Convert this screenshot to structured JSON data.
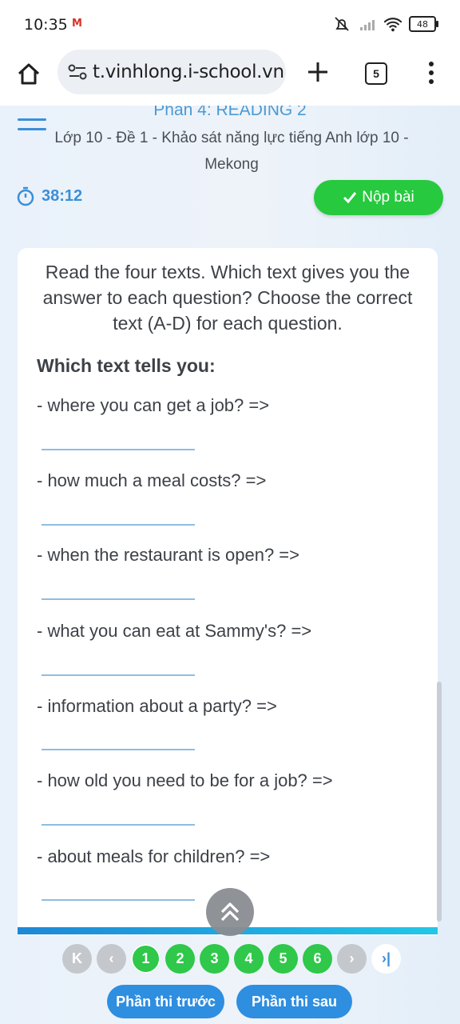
{
  "status": {
    "time": "10:35",
    "gmail": "M",
    "battery": "48"
  },
  "browser": {
    "url": "t.vinhlong.i-school.vn",
    "tab_count": "5"
  },
  "header": {
    "part_title": "Phần 4: READING 2",
    "exam_title": "Lớp 10 - Đề 1 - Khảo sát năng lực tiếng Anh lớp 10 - Mekong",
    "timer": "38:12",
    "submit_label": "Nộp bài"
  },
  "card": {
    "instructions": "Read the four texts. Which text gives you the answer to each question? Choose the correct text (A-D) for each question.",
    "subhead": "Which text tells you:",
    "questions": [
      "- where you can get a job? =>",
      "- how much a meal costs? =>",
      "- when the restaurant is open? =>",
      "- what you can eat at Sammy's? =>",
      "- information about a party? =>",
      "- how old you need to be for a job? =>",
      "- about meals for children? =>"
    ]
  },
  "pager": {
    "first": "K",
    "prev": "‹",
    "pages": [
      "1",
      "2",
      "3",
      "4",
      "5",
      "6"
    ],
    "next": "›",
    "last": "›|"
  },
  "nav": {
    "prev_part": "Phần thi trước",
    "next_part": "Phần thi sau"
  },
  "colors": {
    "accent_blue": "#3a8fd8",
    "submit_green": "#27c93f",
    "page_green": "#2fc84a"
  }
}
